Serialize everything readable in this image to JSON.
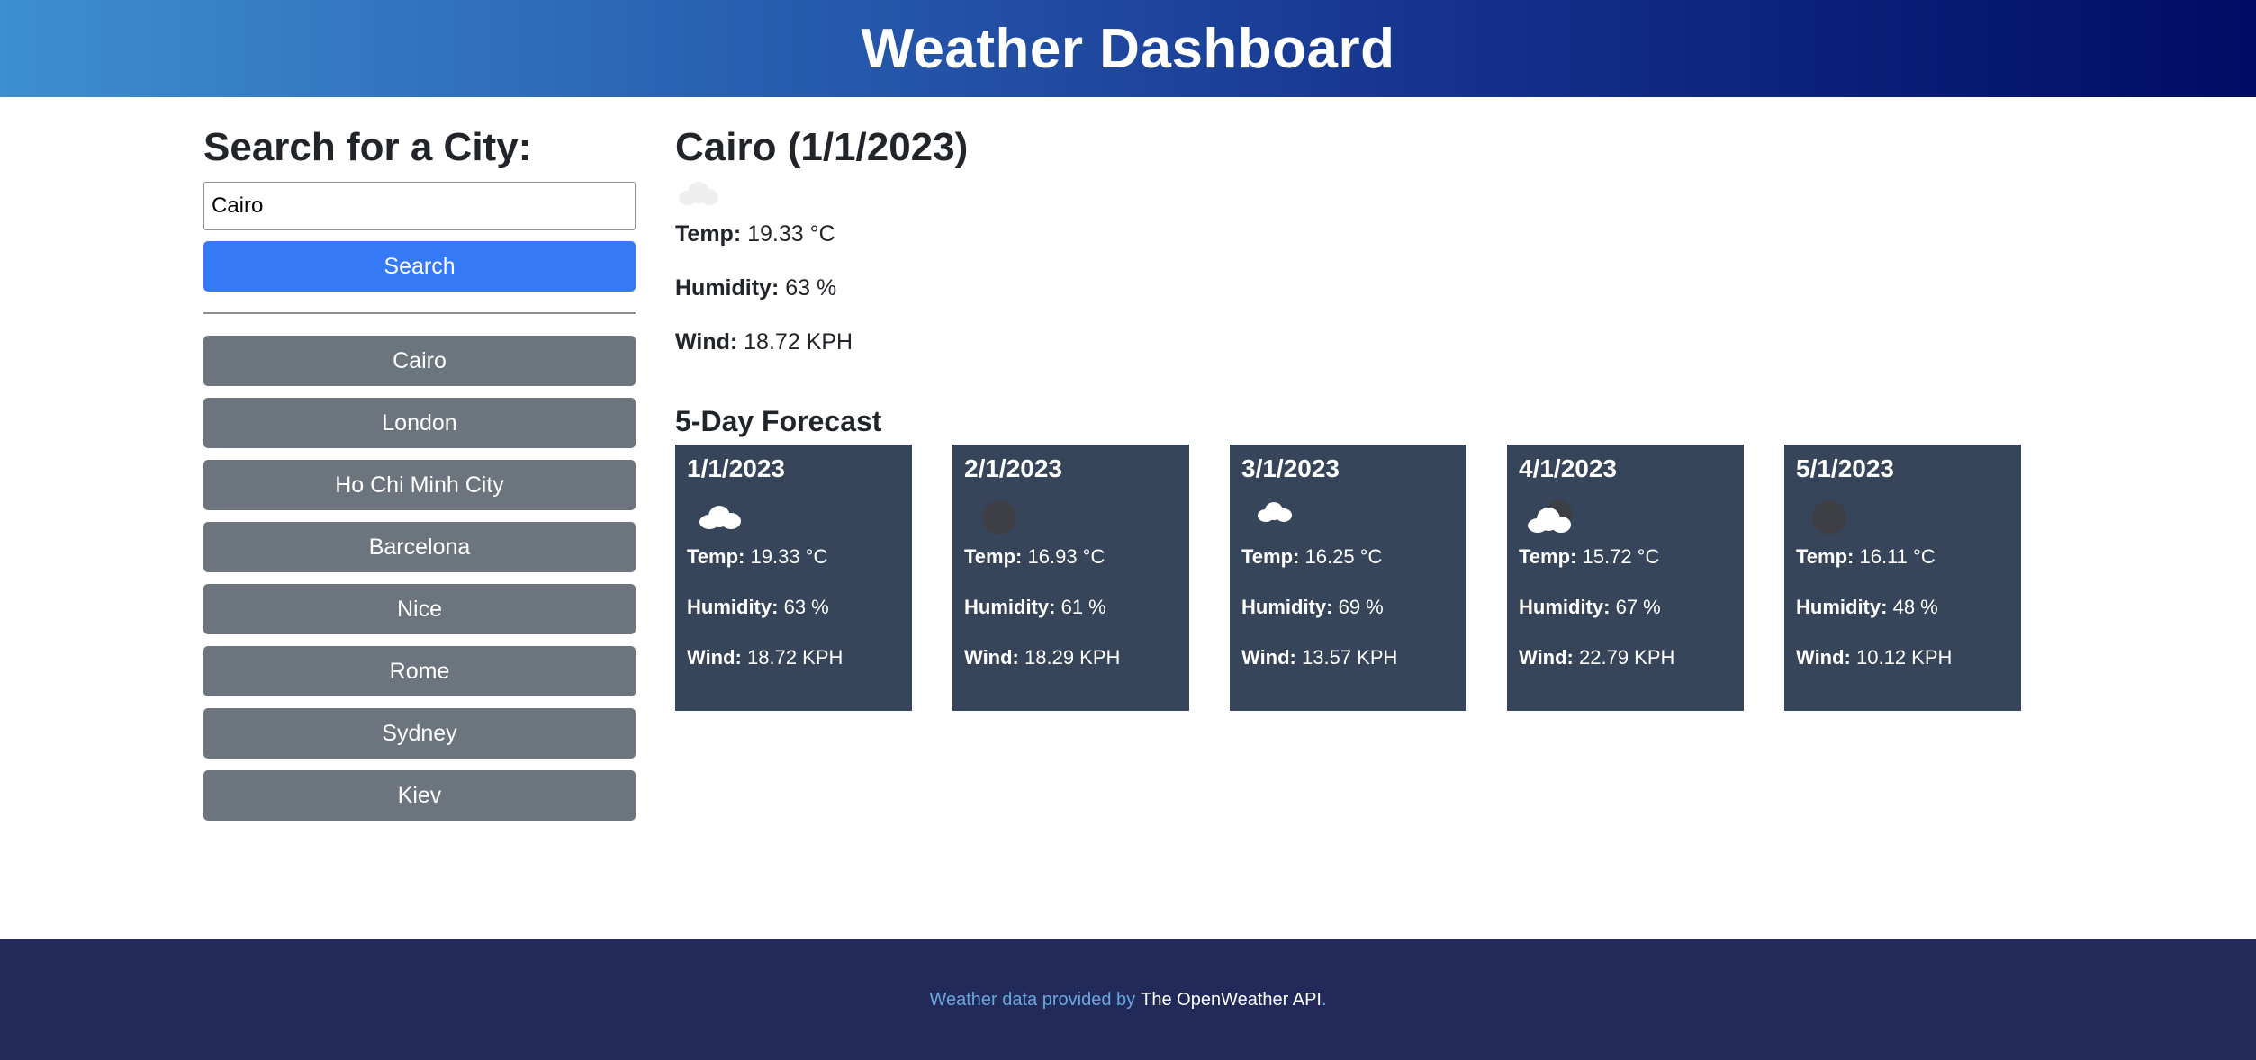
{
  "header": {
    "title": "Weather Dashboard"
  },
  "search": {
    "heading": "Search for a City:",
    "input_value": "Cairo",
    "button_label": "Search"
  },
  "history": [
    "Cairo",
    "London",
    "Ho Chi Minh City",
    "Barcelona",
    "Nice",
    "Rome",
    "Sydney",
    "Kiev"
  ],
  "current": {
    "title": "Cairo (1/1/2023)",
    "icon": "cloud-icon",
    "temp_label": "Temp:",
    "temp_value": "19.33 °C",
    "humidity_label": "Humidity:",
    "humidity_value": "63 %",
    "wind_label": "Wind:",
    "wind_value": "18.72 KPH"
  },
  "forecast": {
    "heading": "5-Day Forecast",
    "days": [
      {
        "date": "1/1/2023",
        "icon": "cloud-icon",
        "temp": "19.33 °C",
        "humidity": "63 %",
        "wind": "18.72 KPH"
      },
      {
        "date": "2/1/2023",
        "icon": "dark-cloud-icon",
        "temp": "16.93 °C",
        "humidity": "61 %",
        "wind": "18.29 KPH"
      },
      {
        "date": "3/1/2023",
        "icon": "cloud-icon",
        "temp": "16.25 °C",
        "humidity": "69 %",
        "wind": "13.57 KPH"
      },
      {
        "date": "4/1/2023",
        "icon": "partly-cloudy-icon",
        "temp": "15.72 °C",
        "humidity": "67 %",
        "wind": "22.79 KPH"
      },
      {
        "date": "5/1/2023",
        "icon": "dark-cloud-icon",
        "temp": "16.11 °C",
        "humidity": "48 %",
        "wind": "10.12 KPH"
      }
    ],
    "labels": {
      "temp": "Temp:",
      "humidity": "Humidity:",
      "wind": "Wind:"
    }
  },
  "footer": {
    "prefix": "Weather data provided by",
    "link_text": "The OpenWeather API",
    "suffix": "."
  },
  "colors": {
    "search_button": "#3579f6",
    "history_button": "#6c757d",
    "card_bg": "#364559",
    "footer_bg": "#222a5a",
    "footer_text": "#6aa7df"
  }
}
